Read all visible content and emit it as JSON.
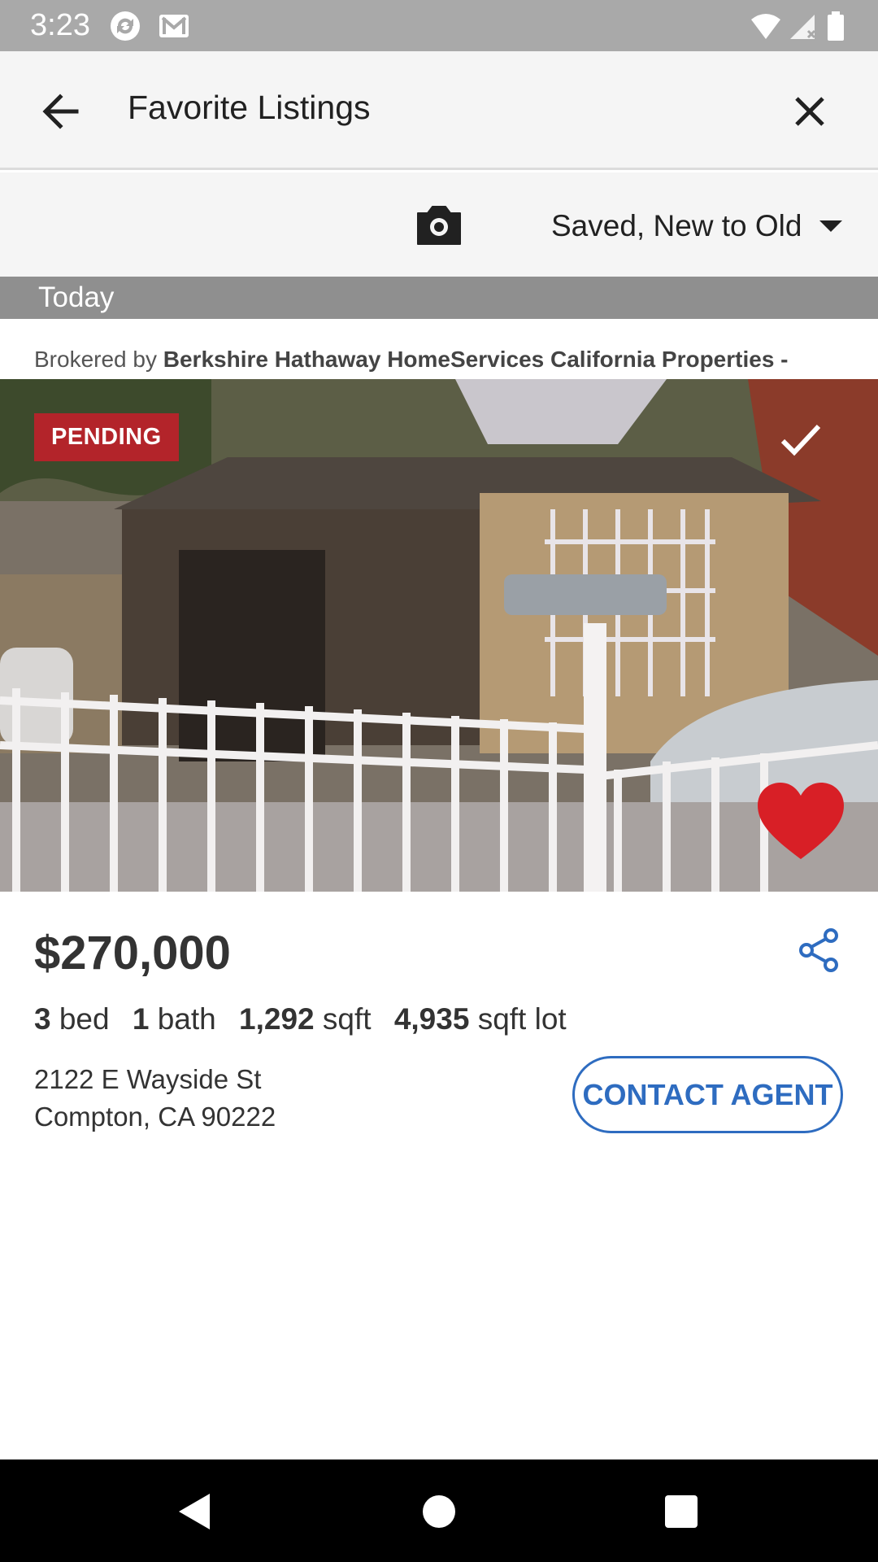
{
  "status_bar": {
    "time": "3:23",
    "icons": [
      "sync-icon",
      "gmail-icon",
      "wifi-icon",
      "signal-icon",
      "battery-icon"
    ]
  },
  "app_bar": {
    "title": "Favorite Listings",
    "back_icon": "arrow-back-icon",
    "close_icon": "close-icon"
  },
  "toolbar": {
    "camera_icon": "camera-icon",
    "sort_label": "Saved, New to Old"
  },
  "section": {
    "label": "Today"
  },
  "listing": {
    "broker_prefix": "Brokered by",
    "broker_name": "Berkshire Hathaway HomeServices California Properties -",
    "status": "PENDING",
    "price": "$270,000",
    "beds_value": "3",
    "beds_unit": "bed",
    "baths_value": "1",
    "baths_unit": "bath",
    "sqft_value": "1,292",
    "sqft_unit": "sqft",
    "lot_value": "4,935",
    "lot_unit": "sqft lot",
    "address_line1": "2122 E Wayside St",
    "address_line2": "Compton, CA 90222",
    "contact_label": "CONTACT AGENT",
    "favorited": true
  },
  "colors": {
    "accent": "#2e6cc0",
    "pending": "#b3242a",
    "heart": "#d81f26",
    "section_header": "#8f8f8f"
  },
  "nav_bar": {
    "icons": [
      "nav-back-icon",
      "nav-home-icon",
      "nav-recents-icon"
    ]
  }
}
